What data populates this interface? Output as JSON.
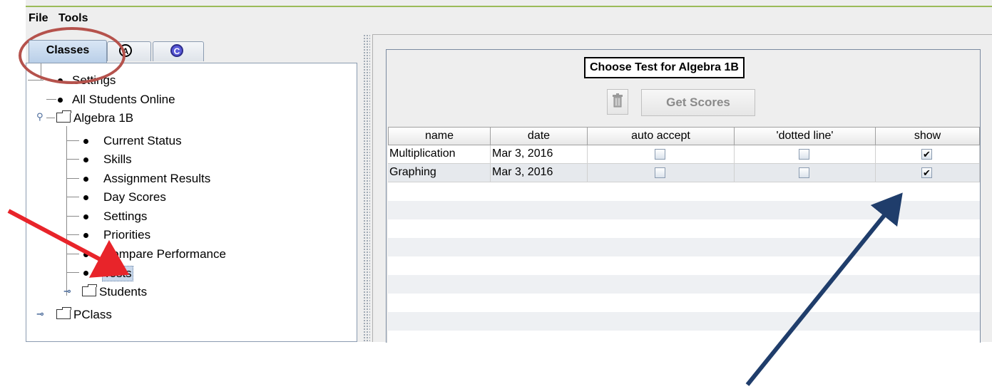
{
  "menu": {
    "file": "File",
    "tools": "Tools"
  },
  "tabs": {
    "classes": "Classes",
    "a": "A",
    "c": "C"
  },
  "tree": {
    "settings": "Settings",
    "all_students_online": "All Students Online",
    "class_name": "Algebra 1B",
    "class_items": [
      "Current Status",
      "Skills",
      "Assignment Results",
      "Day Scores",
      "Settings",
      "Priorities",
      "Compare Performance",
      "Tests"
    ],
    "students": "Students",
    "pclass": "PClass"
  },
  "panel": {
    "title": "Choose Test for Algebra 1B",
    "get_scores": "Get Scores",
    "trash_icon": "trash-icon"
  },
  "table": {
    "columns": [
      "name",
      "date",
      "auto accept",
      "'dotted line'",
      "show"
    ],
    "rows": [
      {
        "name": "Multiplication",
        "date": "Mar 3, 2016",
        "auto_accept": false,
        "dotted_line": false,
        "show": true
      },
      {
        "name": "Graphing",
        "date": "Mar 3, 2016",
        "auto_accept": false,
        "dotted_line": false,
        "show": true
      }
    ]
  },
  "colors": {
    "red_arrow": "#e8242a",
    "blue_arrow": "#1f3d6b",
    "ellipse": "#b5524c",
    "top_rule": "#9bbb59"
  }
}
